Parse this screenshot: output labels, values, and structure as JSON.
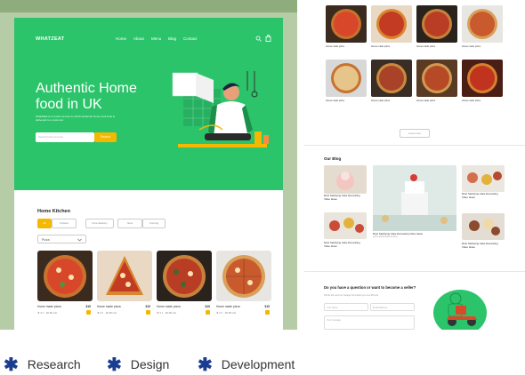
{
  "brand": "WHATZEAT",
  "nav": [
    "Home",
    "About",
    "Menu",
    "Blog",
    "Contact"
  ],
  "hero": {
    "title": "Authentic Home food in UK",
    "desc": "WhatZEat is a courier service in which authentic home cook food is delivered to a customer.",
    "search_placeholder": "Search food you love",
    "search_button": "Search"
  },
  "kitchen": {
    "title": "Home Kitchen",
    "tabs": [
      "All",
      "Cuisine",
      "Free delivery",
      "New",
      "Coming"
    ],
    "filter": "Pizza"
  },
  "product": {
    "name": "Home made pizza",
    "price": "$19",
    "rating": "4.7",
    "time": "30-35 min"
  },
  "load_more": "Load more",
  "blog": {
    "title": "Our Blog",
    "caption": "Most Satisfying Cake Decorating Video Ideas",
    "sub": "Lorem ipsum dolor sit amet"
  },
  "contact": {
    "title": "Do you have a question or want to become a seller?",
    "sub": "Fill this form and our manager will contact you next 48 hours.",
    "name_placeholder": "Your Name",
    "email_placeholder": "Email Address",
    "message_placeholder": "Your message"
  },
  "footer_tags": [
    "Research",
    "Design",
    "Development"
  ],
  "colors": {
    "brand_green": "#2cc46b",
    "accent_yellow": "#f5b800",
    "star_blue": "#1a3d8f"
  }
}
